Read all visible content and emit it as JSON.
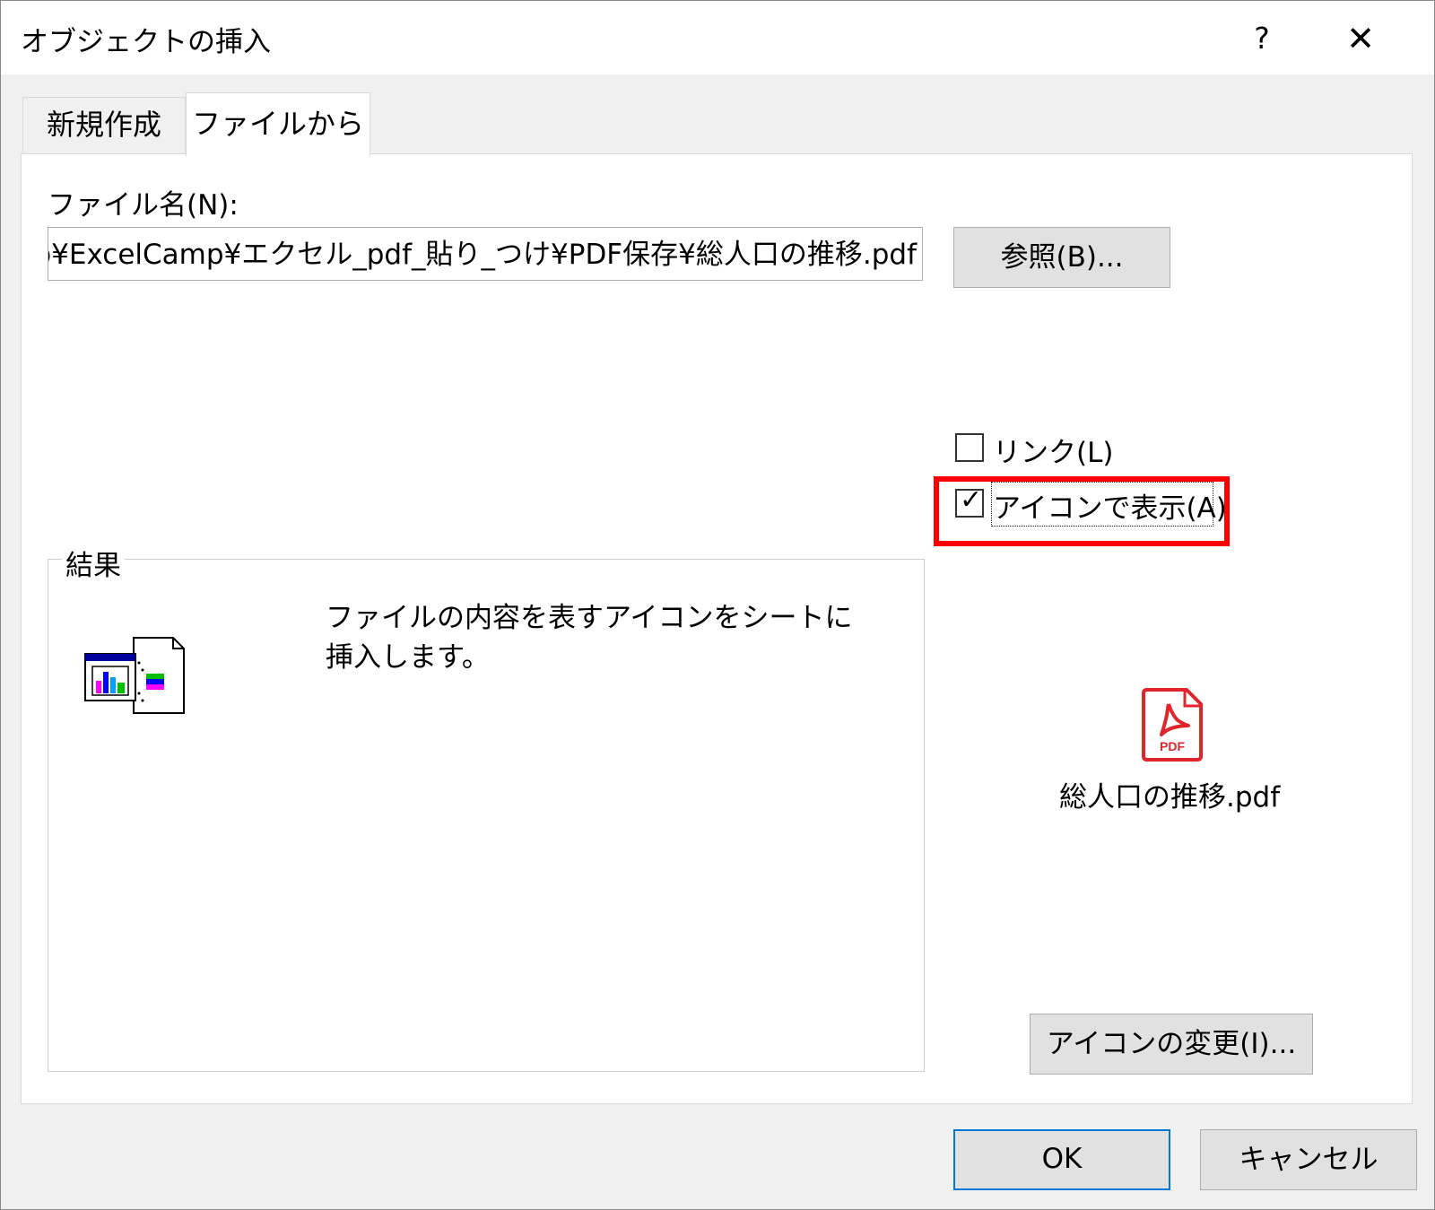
{
  "dialog": {
    "title": "オブジェクトの挿入",
    "help_label": "?",
    "close_label": "✕"
  },
  "tabs": [
    {
      "label": "新規作成",
      "active": false
    },
    {
      "label": "ファイルから",
      "active": true
    }
  ],
  "file": {
    "label": "ファイル名(N):",
    "value": "op¥ExcelCamp¥エクセル_pdf_貼り_つけ¥PDF保存¥総人口の推移.pdf",
    "browse_label": "参照(B)..."
  },
  "options": {
    "link_label": "リンク(L)",
    "link_checked": false,
    "display_as_icon_label": "アイコンで表示(A)",
    "display_as_icon_checked": true,
    "checkmark": "✓"
  },
  "result": {
    "legend": "結果",
    "description": "ファイルの内容を表すアイコンをシートに挿入します。"
  },
  "icon_preview": {
    "icon_name": "pdf-file-icon",
    "badge_text": "PDF",
    "file_name": "総人口の推移.pdf",
    "change_icon_label": "アイコンの変更(I)..."
  },
  "footer": {
    "ok_label": "OK",
    "cancel_label": "キャンセル"
  },
  "colors": {
    "highlight": "#ff0000",
    "ok_border": "#0078d7",
    "pdf_red": "#e2242b"
  }
}
